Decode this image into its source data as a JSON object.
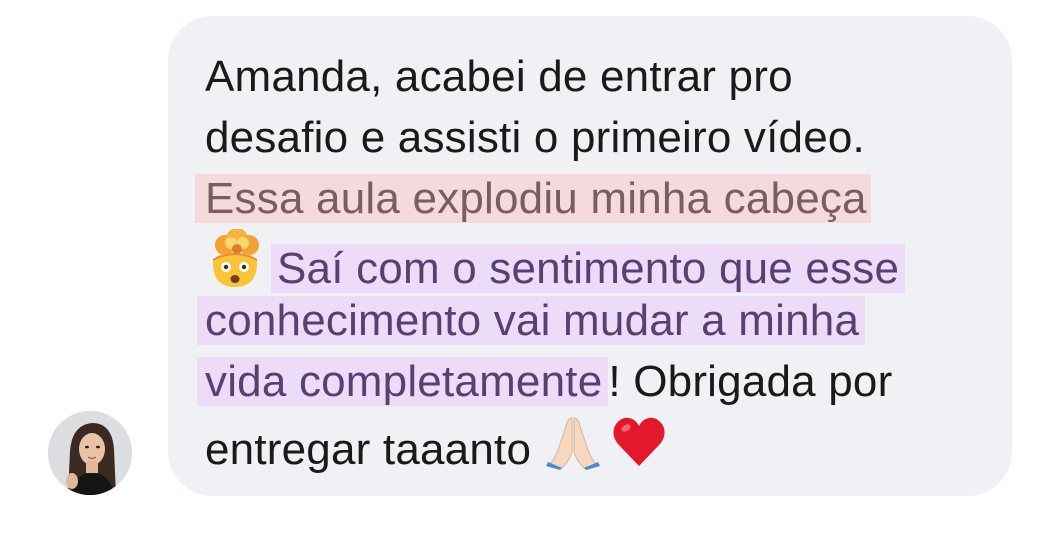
{
  "avatar": {
    "icon": "user-avatar-photo"
  },
  "message": {
    "line1": "Amanda, acabei de entrar pro",
    "line2": "desafio e assisti o primeiro vídeo.",
    "line3_highlight": "Essa aula explodiu minha cabeça",
    "line4_emoji": "exploding-head-icon",
    "line4_highlight": "Saí com o sentimento que esse",
    "line5_highlight": "conhecimento vai mudar a minha",
    "line6_highlight": "vida completamente",
    "line6_text": "! Obrigada por",
    "line7_text": "entregar taaanto",
    "line7_emojis": [
      "folded-hands-icon",
      "heart-icon"
    ]
  },
  "colors": {
    "bubble": "#f0f1f4",
    "highlight_red": "#f6d9dc",
    "highlight_purple": "#ecdcf8",
    "text": "#1a1a1a"
  }
}
